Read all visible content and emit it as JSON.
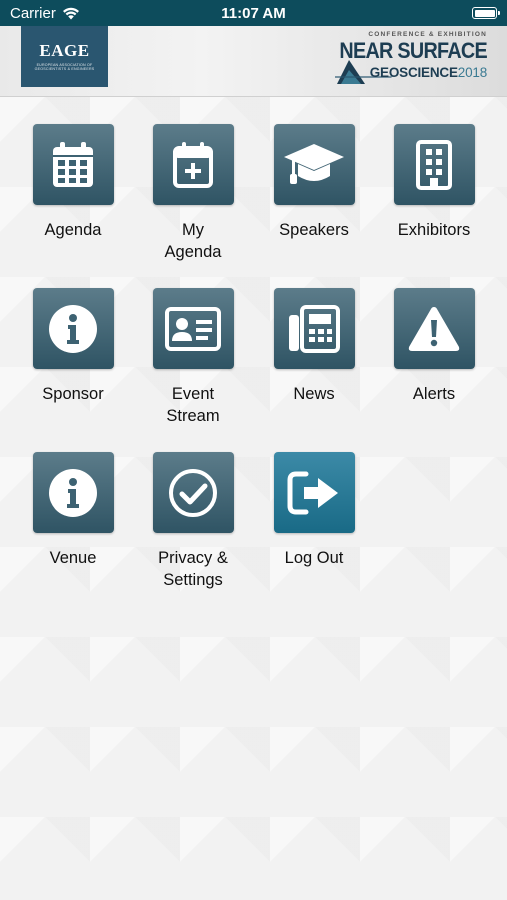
{
  "status_bar": {
    "carrier": "Carrier",
    "time": "11:07 AM"
  },
  "header": {
    "eage": {
      "title": "EAGE",
      "subtitle": "EUROPEAN ASSOCIATION OF GEOSCIENTISTS & ENGINEERS"
    },
    "conference": {
      "top": "CONFERENCE & EXHIBITION",
      "name": "NEAR SURFACE",
      "geo": "GEOSCIENCE",
      "year": "2018"
    }
  },
  "tiles": [
    {
      "label": "Agenda",
      "icon": "calendar-icon"
    },
    {
      "label": "My\nAgenda",
      "icon": "calendar-plus-icon"
    },
    {
      "label": "Speakers",
      "icon": "graduation-cap-icon"
    },
    {
      "label": "Exhibitors",
      "icon": "building-icon"
    },
    {
      "label": "Sponsor",
      "icon": "info-icon"
    },
    {
      "label": "Event\nStream",
      "icon": "id-card-icon"
    },
    {
      "label": "News",
      "icon": "fax-icon"
    },
    {
      "label": "Alerts",
      "icon": "warning-icon"
    },
    {
      "label": "Venue",
      "icon": "info-icon"
    },
    {
      "label": "Privacy &\nSettings",
      "icon": "check-circle-icon"
    },
    {
      "label": "Log Out",
      "icon": "sign-out-icon"
    }
  ],
  "colors": {
    "status_bar": "#0d4c5c",
    "tile": "#2f5464",
    "tile_accent": "#196a86"
  }
}
